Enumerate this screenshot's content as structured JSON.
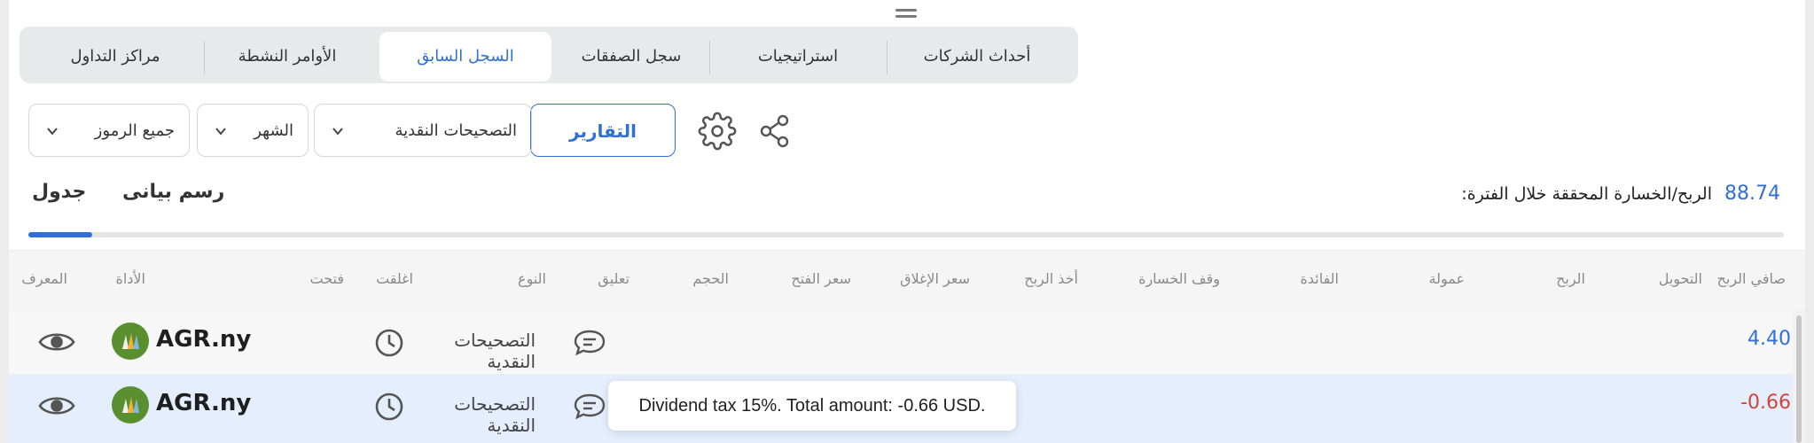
{
  "top_tabs": [
    {
      "label": "أحداث الشركات",
      "active": false
    },
    {
      "label": "استراتيجيات",
      "active": false
    },
    {
      "label": "سجل الصفقات",
      "active": false
    },
    {
      "label": "السجل السابق",
      "active": true
    },
    {
      "label": "الأوامر النشطة",
      "active": false
    },
    {
      "label": "مراكز التداول",
      "active": false
    }
  ],
  "toolbar": {
    "reports_label": "التقارير",
    "filters": [
      {
        "value": "التصحيحات النقدية"
      },
      {
        "value": "الشهر"
      },
      {
        "value": "جميع الرموز"
      }
    ]
  },
  "summary": {
    "pnl_value": "88.74",
    "pnl_label": ":الربح/الخسارة المحققة خلال الفترة"
  },
  "view_tabs": {
    "chart_label": "رسم بيانى",
    "table_label": "جدول",
    "active": "table"
  },
  "table": {
    "columns": [
      "صافي الربح",
      "التحويل",
      "الربح",
      "عمولة",
      "الفائدة",
      "وقف الخسارة",
      "أخذ الربح",
      "سعر الإغلاق",
      "سعر الفتح",
      "الحجم",
      "تعليق",
      "النوع",
      "اغلقت",
      "فتحت",
      "الأداة",
      "المعرف"
    ],
    "rows": [
      {
        "symbol": "AGR.ny",
        "type": "التصحيحات النقدية",
        "net_profit": "4.40"
      },
      {
        "symbol": "AGR.ny",
        "type": "التصحيحات النقدية",
        "net_profit": "-0.66"
      }
    ]
  },
  "tooltip": {
    "text": "Dividend tax 15%. Total amount: -0.66 USD."
  },
  "colors": {
    "accent": "#2f6fd8",
    "negative": "#d0463a",
    "row_selected": "#e4eefc"
  },
  "icons": [
    "drag-handle-icon",
    "share-icon",
    "gear-icon",
    "chevron-down-icon",
    "eye-icon",
    "clock-icon",
    "comment-icon"
  ]
}
